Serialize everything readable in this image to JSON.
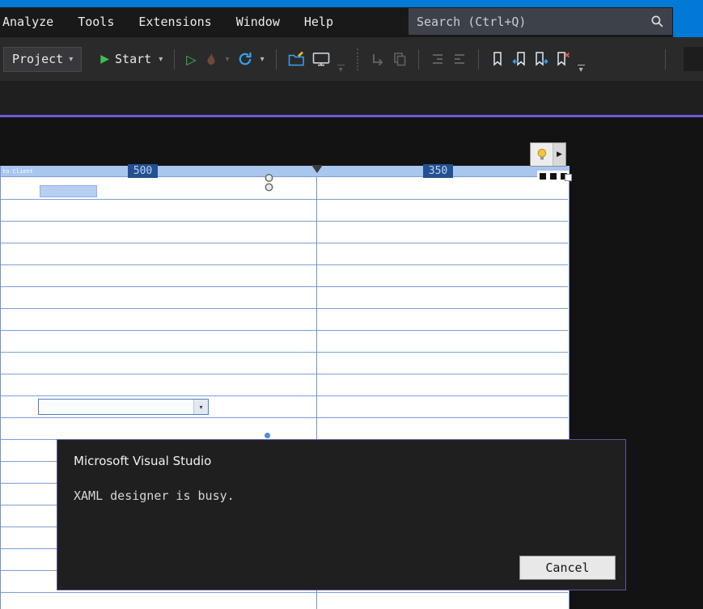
{
  "menu_bar": {
    "items": [
      "Analyze",
      "Tools",
      "Extensions",
      "Window",
      "Help"
    ],
    "search_placeholder": "Search (Ctrl+Q)"
  },
  "toolbar": {
    "project_label": "Project",
    "start_label": "Start"
  },
  "glyphs": {
    "caret_down": "▾",
    "play_filled": "▶",
    "play_outline": "▷",
    "triangle_right": "▶"
  },
  "designer": {
    "edge_label": "to Client",
    "col_widths": [
      "500",
      "350"
    ]
  },
  "dialog": {
    "app_title": "Microsoft Visual Studio",
    "message": "XAML designer is busy.",
    "cancel_label": "Cancel"
  },
  "colors": {
    "titlebar_blue": "#0179d7",
    "accent_purple": "#6f5ad6",
    "grid_line_blue": "#7b9ed6",
    "column_chip_blue": "#24508f",
    "start_green": "#3fbf4e",
    "reload_blue": "#35a2ee",
    "clear_red": "#e05a5a",
    "bulb_yellow": "#f5c43d"
  }
}
